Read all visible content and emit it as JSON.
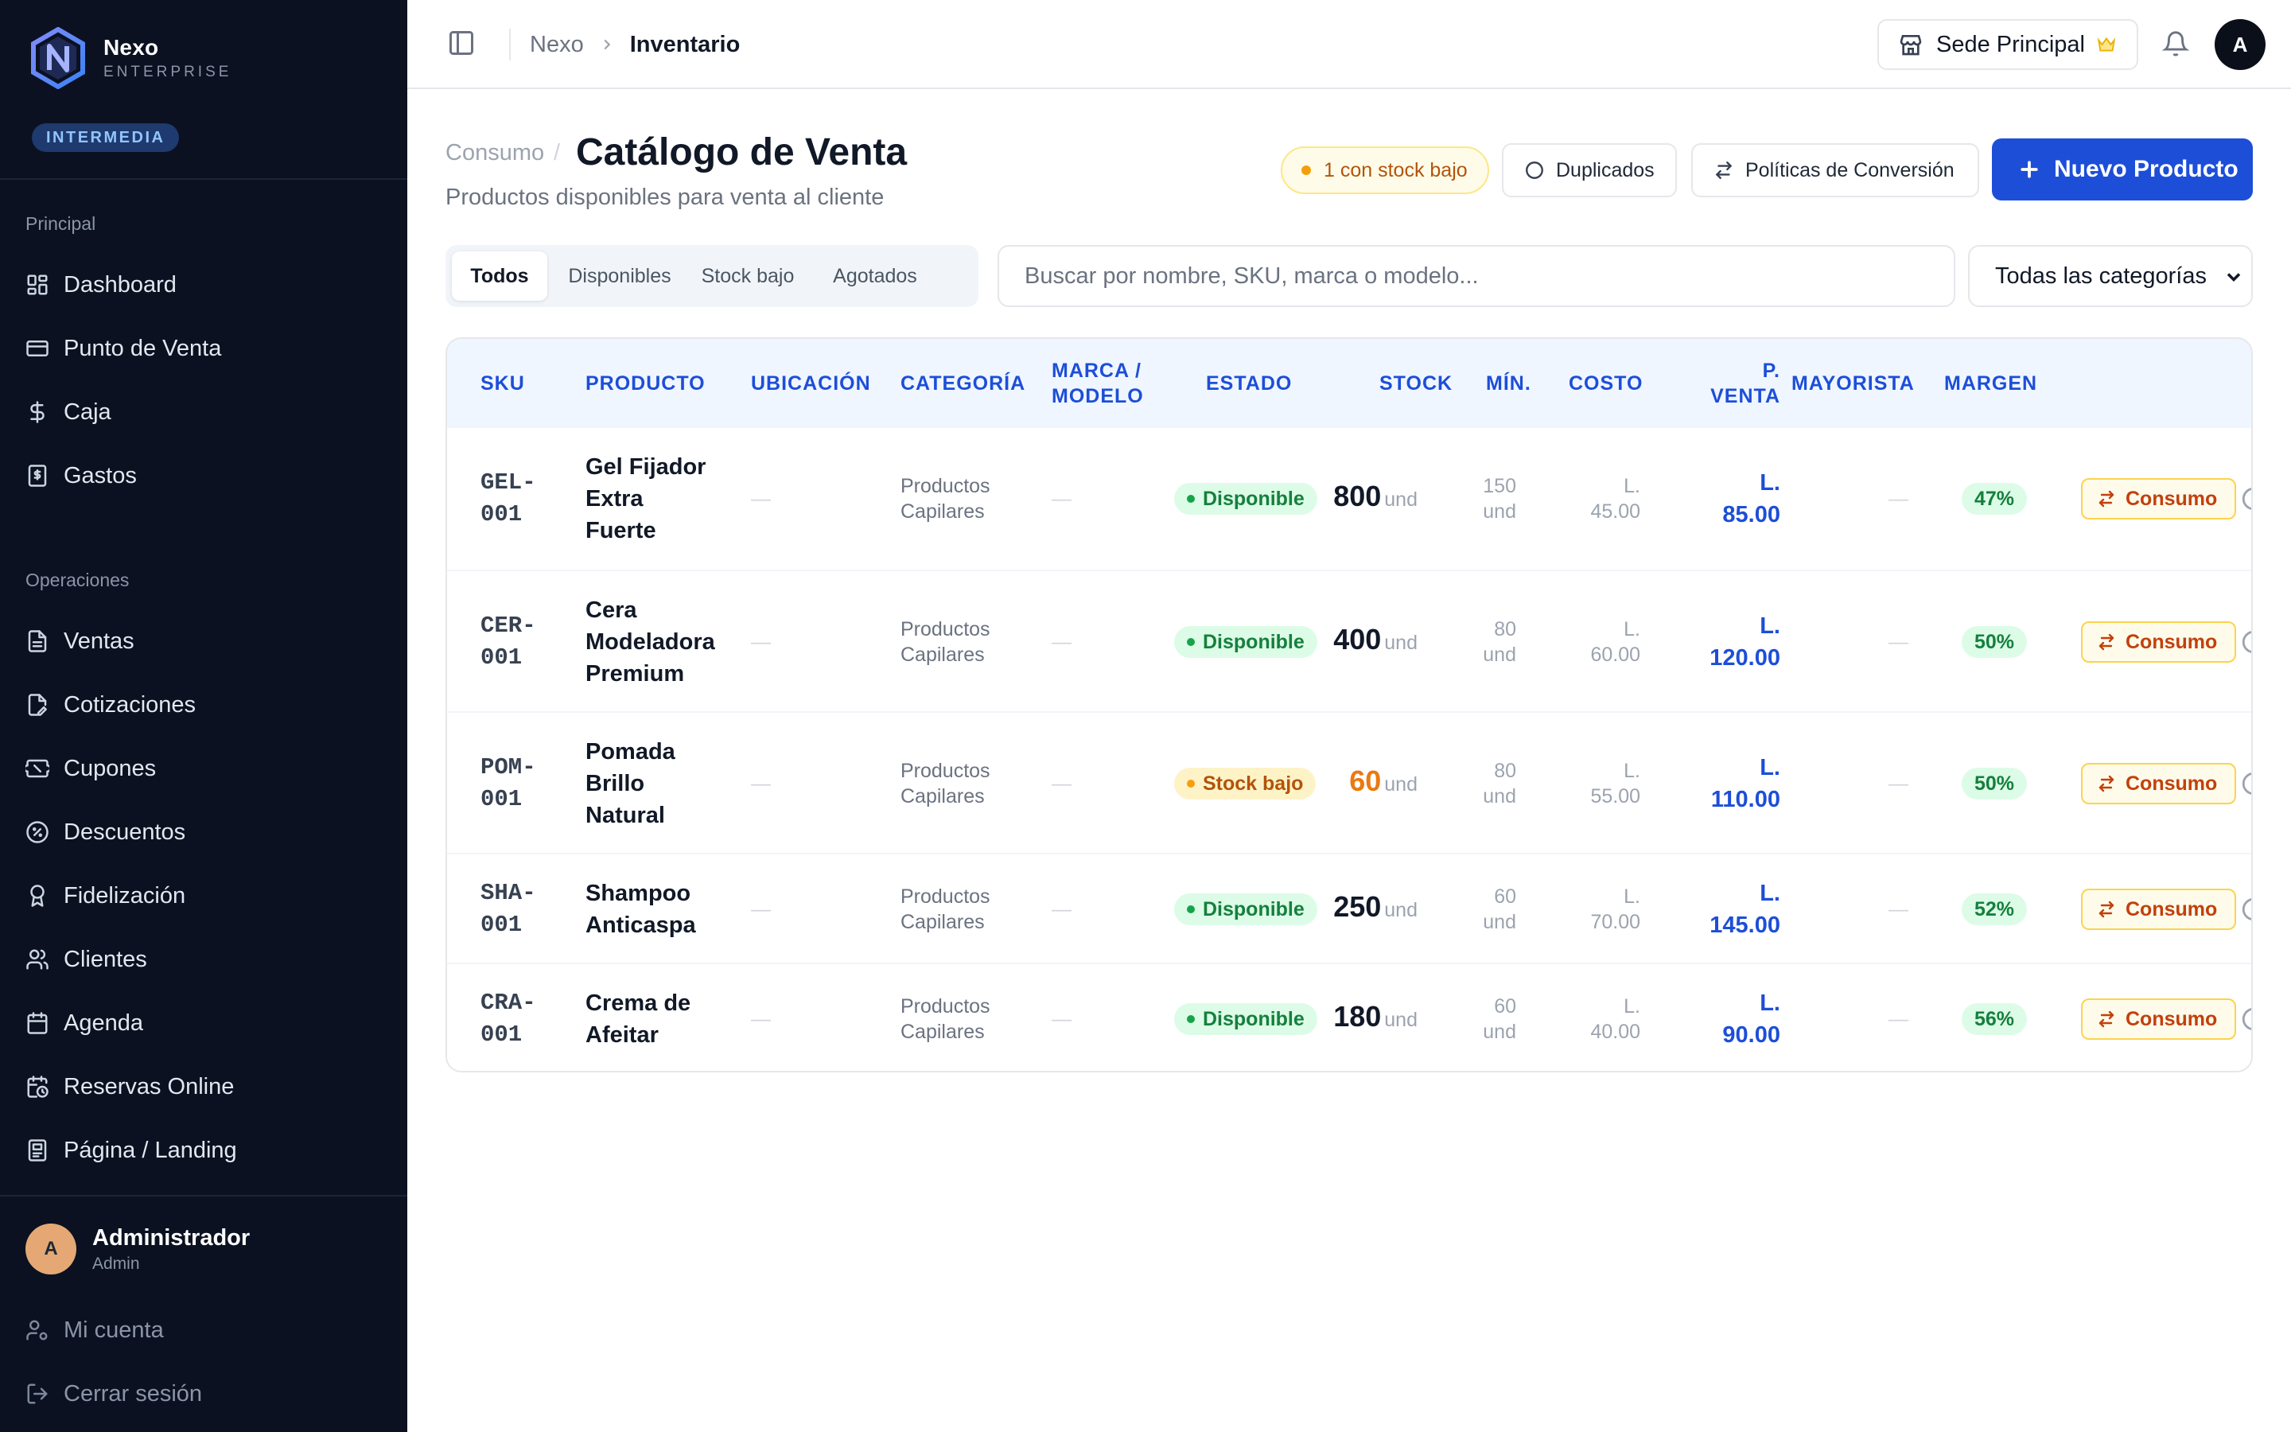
{
  "brand": {
    "name": "Nexo",
    "sub": "ENTERPRISE",
    "plan": "INTERMEDIA"
  },
  "sidebar": {
    "sections": [
      {
        "label": "Principal",
        "items": [
          {
            "label": "Dashboard",
            "icon": "dashboard-icon"
          },
          {
            "label": "Punto de Venta",
            "icon": "credit-card-icon"
          },
          {
            "label": "Caja",
            "icon": "dollar-icon"
          },
          {
            "label": "Gastos",
            "icon": "receipt-icon"
          }
        ]
      },
      {
        "label": "Operaciones",
        "items": [
          {
            "label": "Ventas",
            "icon": "file-icon"
          },
          {
            "label": "Cotizaciones",
            "icon": "file-edit-icon"
          },
          {
            "label": "Cupones",
            "icon": "ticket-icon"
          },
          {
            "label": "Descuentos",
            "icon": "badge-percent-icon"
          },
          {
            "label": "Fidelización",
            "icon": "award-icon"
          },
          {
            "label": "Clientes",
            "icon": "users-icon"
          },
          {
            "label": "Agenda",
            "icon": "calendar-icon"
          },
          {
            "label": "Reservas Online",
            "icon": "calendar-clock-icon"
          },
          {
            "label": "Página / Landing",
            "icon": "layout-icon"
          }
        ]
      }
    ],
    "user": {
      "initial": "A",
      "name": "Administrador",
      "role": "Admin"
    },
    "account": [
      {
        "label": "Mi cuenta",
        "icon": "user-cog-icon"
      },
      {
        "label": "Cerrar sesión",
        "icon": "logout-icon"
      }
    ]
  },
  "topbar": {
    "breadcrumb_root": "Nexo",
    "breadcrumb_current": "Inventario",
    "sede": "Sede Principal",
    "avatar": "A"
  },
  "header": {
    "pre": "Consumo",
    "slash": "/",
    "title": "Catálogo de Venta",
    "subtitle": "Productos disponibles para venta al cliente",
    "low_stock_chip": "1 con stock bajo",
    "duplicados": "Duplicados",
    "politicas": "Políticas de Conversión",
    "nuevo": "Nuevo Producto"
  },
  "filters": {
    "tabs": [
      "Todos",
      "Disponibles",
      "Stock bajo",
      "Agotados"
    ],
    "active_tab": "Todos",
    "search_placeholder": "Buscar por nombre, SKU, marca o modelo...",
    "category": "Todas las categorías"
  },
  "table": {
    "headers": {
      "sku": "SKU",
      "producto": "PRODUCTO",
      "ubicacion": "UBICACIÓN",
      "categoria": "CATEGORÍA",
      "marca_1": "MARCA /",
      "marca_2": "MODELO",
      "estado": "ESTADO",
      "stock": "STOCK",
      "min": "MÍN.",
      "costo": "COSTO",
      "pventa_1": "P.",
      "pventa_2": "VENTA",
      "mayorista": "MAYORISTA",
      "margen": "MARGEN"
    },
    "rows": [
      {
        "sku_1": "GEL-",
        "sku_2": "001",
        "name": [
          "Gel Fijador",
          "Extra",
          "Fuerte"
        ],
        "ubicacion": "—",
        "cat_1": "Productos",
        "cat_2": "Capilares",
        "marca": "—",
        "estado": "Disponible",
        "estado_kind": "ok",
        "stock": "800",
        "unit": "und",
        "min_1": "150",
        "min_2": "und",
        "costo_1": "L.",
        "costo_2": "45.00",
        "precio_1": "L.",
        "precio_2": "85.00",
        "mayorista": "—",
        "margen": "47%",
        "conversion": "Consumo"
      },
      {
        "sku_1": "CER-",
        "sku_2": "001",
        "name": [
          "Cera",
          "Modeladora",
          "Premium"
        ],
        "ubicacion": "—",
        "cat_1": "Productos",
        "cat_2": "Capilares",
        "marca": "—",
        "estado": "Disponible",
        "estado_kind": "ok",
        "stock": "400",
        "unit": "und",
        "min_1": "80",
        "min_2": "und",
        "costo_1": "L.",
        "costo_2": "60.00",
        "precio_1": "L.",
        "precio_2": "120.00",
        "mayorista": "—",
        "margen": "50%",
        "conversion": "Consumo"
      },
      {
        "sku_1": "POM-",
        "sku_2": "001",
        "name": [
          "Pomada",
          "Brillo",
          "Natural"
        ],
        "ubicacion": "—",
        "cat_1": "Productos",
        "cat_2": "Capilares",
        "marca": "—",
        "estado": "Stock bajo",
        "estado_kind": "low",
        "stock": "60",
        "unit": "und",
        "min_1": "80",
        "min_2": "und",
        "costo_1": "L.",
        "costo_2": "55.00",
        "precio_1": "L.",
        "precio_2": "110.00",
        "mayorista": "—",
        "margen": "50%",
        "conversion": "Consumo"
      },
      {
        "sku_1": "SHA-",
        "sku_2": "001",
        "name": [
          "Shampoo",
          "Anticaspa"
        ],
        "ubicacion": "—",
        "cat_1": "Productos",
        "cat_2": "Capilares",
        "marca": "—",
        "estado": "Disponible",
        "estado_kind": "ok",
        "stock": "250",
        "unit": "und",
        "min_1": "60",
        "min_2": "und",
        "costo_1": "L.",
        "costo_2": "70.00",
        "precio_1": "L.",
        "precio_2": "145.00",
        "mayorista": "—",
        "margen": "52%",
        "conversion": "Consumo"
      },
      {
        "sku_1": "CRA-",
        "sku_2": "001",
        "name": [
          "Crema de",
          "Afeitar"
        ],
        "ubicacion": "—",
        "cat_1": "Productos",
        "cat_2": "Capilares",
        "marca": "—",
        "estado": "Disponible",
        "estado_kind": "ok",
        "stock": "180",
        "unit": "und",
        "min_1": "60",
        "min_2": "und",
        "costo_1": "L.",
        "costo_2": "40.00",
        "precio_1": "L.",
        "precio_2": "90.00",
        "mayorista": "—",
        "margen": "56%",
        "conversion": "Consumo"
      }
    ]
  },
  "colors": {
    "sidebar_bg": "#0b1121",
    "accent": "#1d4ed8",
    "success": "#15803d",
    "warning": "#b45309",
    "conversion": "#c2410c"
  }
}
